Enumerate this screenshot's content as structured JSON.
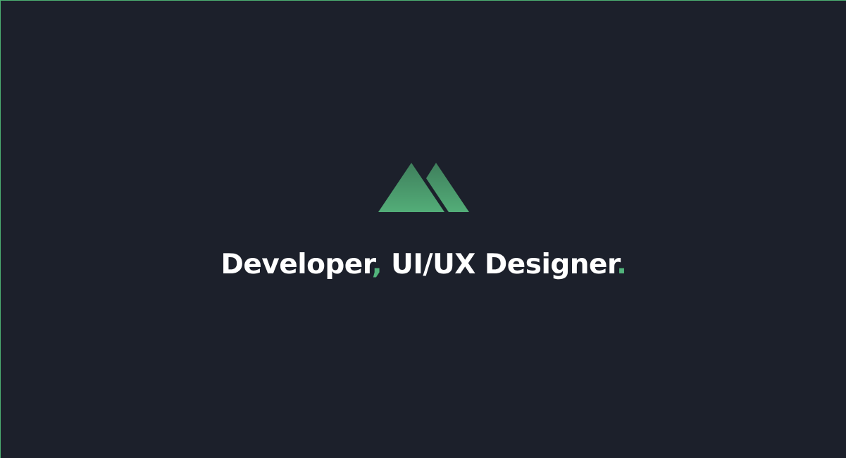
{
  "tagline": {
    "part1": "Developer",
    "comma": ",",
    "part2": " UI/UX Designer",
    "period": "."
  },
  "colors": {
    "background": "#1c202b",
    "accent": "#52b47c",
    "text": "#ffffff"
  },
  "logo": {
    "icon": "mountain-logo-icon"
  }
}
